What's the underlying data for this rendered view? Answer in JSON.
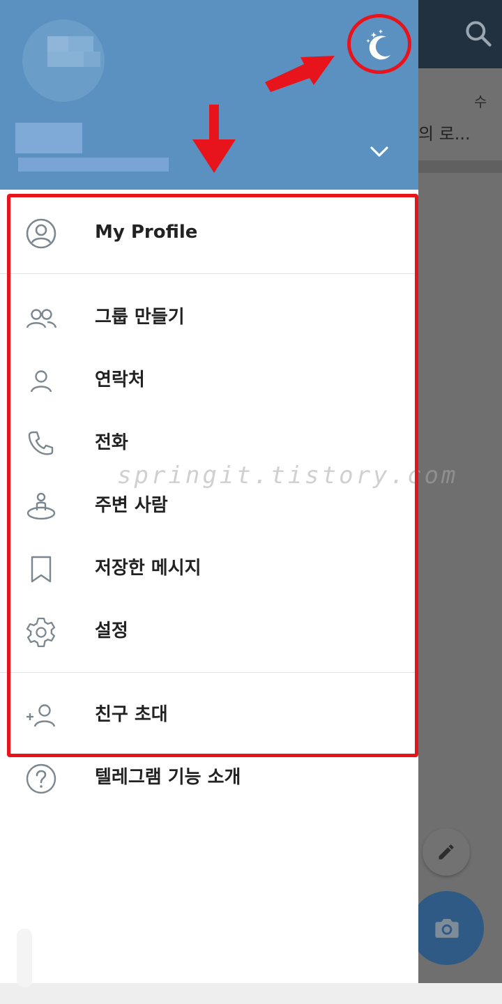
{
  "background_app": {
    "chat_time": "수",
    "chat_preview": "의 로..."
  },
  "drawer": {
    "night_mode_icon": "moon-stars-icon",
    "expand_icon": "chevron-down-icon",
    "menu": [
      {
        "label": "My Profile",
        "icon": "profile-circle-icon"
      },
      {
        "label": "그룹 만들기",
        "icon": "group-icon"
      },
      {
        "label": "연락처",
        "icon": "contact-icon"
      },
      {
        "label": "전화",
        "icon": "phone-icon"
      },
      {
        "label": "주변 사람",
        "icon": "people-nearby-icon"
      },
      {
        "label": "저장한 메시지",
        "icon": "bookmark-icon"
      },
      {
        "label": "설정",
        "icon": "gear-icon"
      },
      {
        "label": "친구 초대",
        "icon": "add-user-icon"
      },
      {
        "label": "텔레그램 기능 소개",
        "icon": "help-icon"
      }
    ]
  },
  "watermark": "springit.tistory.com",
  "colors": {
    "header_blue": "#5b91c1",
    "annotation_red": "#e8141b",
    "icon_gray": "#7c868f"
  }
}
